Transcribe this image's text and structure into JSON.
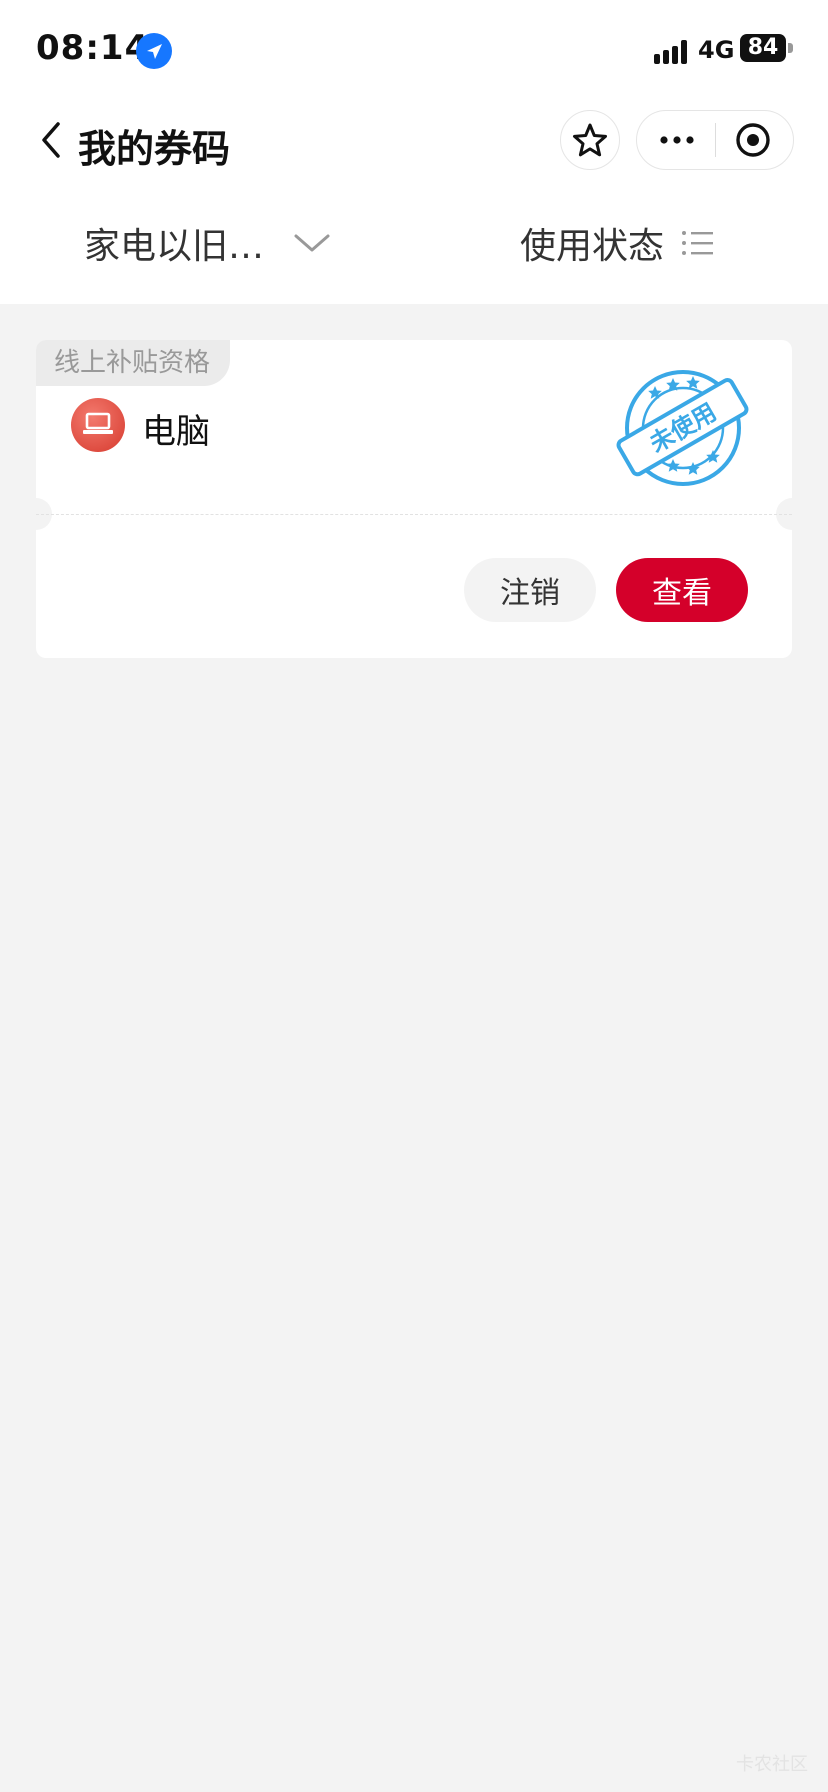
{
  "status_bar": {
    "time": "08:14",
    "network": "4G",
    "battery": "84"
  },
  "nav": {
    "title": "我的券码"
  },
  "filters": {
    "category": "家电以旧…",
    "status": "使用状态"
  },
  "coupon": {
    "tag": "线上补贴资格",
    "device": "电脑",
    "stamp_text": "未使用",
    "cancel_label": "注销",
    "view_label": "查看"
  },
  "watermark": "卡农社区",
  "colors": {
    "accent_red": "#d4002a",
    "stamp_blue": "#3aa8e6",
    "location_blue": "#1677ff"
  }
}
